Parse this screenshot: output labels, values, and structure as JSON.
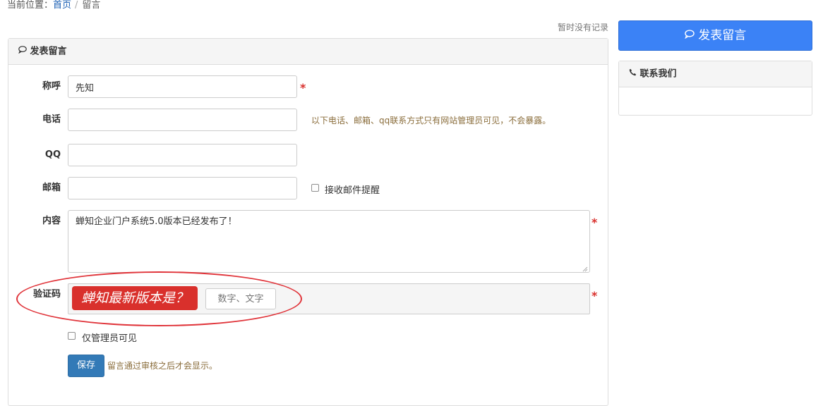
{
  "breadcrumb": {
    "prefix": "当前位置：",
    "home": "首页",
    "separator": "/",
    "current": "留言"
  },
  "list": {
    "empty_text": "暂时没有记录"
  },
  "form": {
    "title": "发表留言",
    "name": {
      "label": "称呼",
      "value": "先知"
    },
    "phone": {
      "label": "电话",
      "value": "",
      "hint": "以下电话、邮箱、qq联系方式只有网站管理员可见，不会暴露。"
    },
    "qq": {
      "label": "QQ",
      "value": ""
    },
    "email": {
      "label": "邮箱",
      "value": "",
      "notify_label": "接收邮件提醒"
    },
    "content": {
      "label": "内容",
      "value": "蝉知企业门户系统5.0版本已经发布了！"
    },
    "captcha": {
      "label": "验证码",
      "question": "蝉知最新版本是？",
      "placeholder": "数字、文字"
    },
    "admin_only_label": "仅管理员可见",
    "required_mark": "*",
    "save_label": "保存",
    "save_hint": "留言通过审核之后才会显示。"
  },
  "sidebar": {
    "post_button_label": "发表留言",
    "contact_title": "联系我们"
  },
  "icons": {
    "comment": "comment-icon",
    "phone": "phone-icon"
  },
  "colors": {
    "primary": "#3b82f6",
    "required": "#d9302c",
    "captcha_bg": "#d9302c",
    "annotation": "#e0343a",
    "hint": "#8a6d3b"
  }
}
